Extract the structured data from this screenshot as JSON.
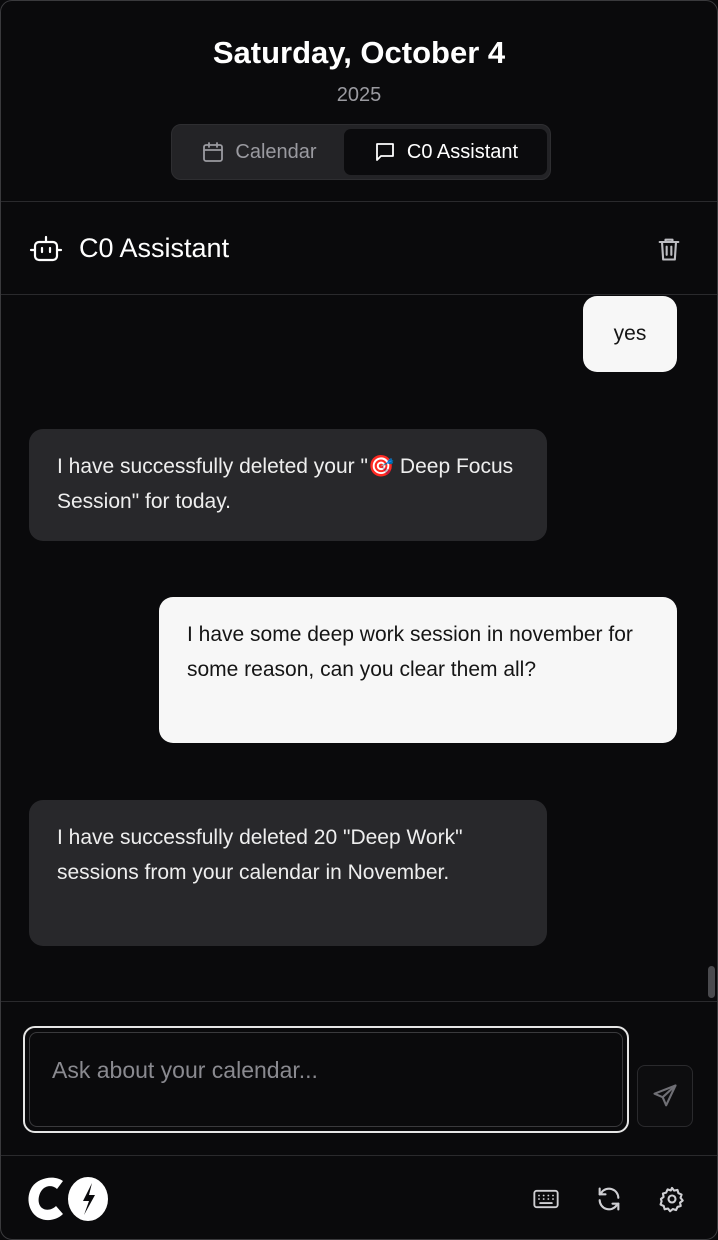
{
  "header": {
    "date_title": "Saturday, October 4",
    "year": "2025",
    "tabs": [
      {
        "label": "Calendar",
        "icon": "calendar-icon",
        "active": false
      },
      {
        "label": "C0 Assistant",
        "icon": "chat-icon",
        "active": true
      }
    ]
  },
  "assistant": {
    "title": "C0 Assistant",
    "icon": "bot-icon",
    "clear_icon": "trash-icon"
  },
  "messages": [
    {
      "role": "user",
      "text": "yes"
    },
    {
      "role": "assistant",
      "text": "I have successfully deleted your \"🎯 Deep Focus Session\" for today."
    },
    {
      "role": "user",
      "text": "I have some deep work session in november for some reason, can you clear them all?"
    },
    {
      "role": "assistant",
      "text": "I have successfully deleted 20 \"Deep Work\" sessions from your calendar in November."
    }
  ],
  "composer": {
    "placeholder": "Ask about your calendar...",
    "value": "",
    "send_icon": "send-icon"
  },
  "footer": {
    "logo": "C0",
    "icons": [
      "keyboard-icon",
      "refresh-icon",
      "gear-icon"
    ]
  },
  "colors": {
    "background": "#0a0a0c",
    "bot_bubble": "#28282b",
    "user_bubble": "#f7f7f7",
    "muted_text": "#9a9aa0"
  }
}
